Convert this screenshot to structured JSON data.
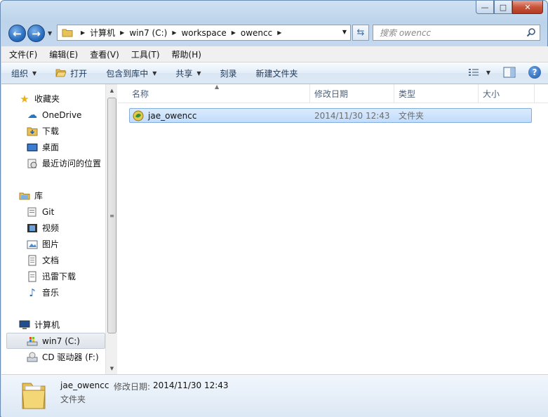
{
  "window": {
    "controls": {
      "minimize": "—",
      "maximize": "□",
      "close": "✕"
    }
  },
  "address": {
    "breadcrumbs": [
      "计算机",
      "win7 (C:)",
      "workspace",
      "owencc"
    ]
  },
  "search": {
    "placeholder": "搜索 owencc"
  },
  "menu": {
    "items": [
      "文件(F)",
      "编辑(E)",
      "查看(V)",
      "工具(T)",
      "帮助(H)"
    ]
  },
  "toolbar": {
    "organize": "组织",
    "open": "打开",
    "include_in_library": "包含到库中",
    "share": "共享",
    "burn": "刻录",
    "new_folder": "新建文件夹"
  },
  "nav": {
    "favorites": {
      "label": "收藏夹",
      "items": [
        "OneDrive",
        "下载",
        "桌面",
        "最近访问的位置"
      ]
    },
    "libraries": {
      "label": "库",
      "items": [
        "Git",
        "视频",
        "图片",
        "文档",
        "迅雷下载",
        "音乐"
      ]
    },
    "computer": {
      "label": "计算机",
      "items": [
        "win7 (C:)",
        "CD 驱动器 (F:)"
      ],
      "selected": "win7 (C:)"
    }
  },
  "columns": {
    "name": "名称",
    "modified": "修改日期",
    "type": "类型",
    "size": "大小"
  },
  "files": [
    {
      "name": "jae_owencc",
      "modified": "2014/11/30 12:43",
      "type": "文件夹",
      "size": ""
    }
  ],
  "details": {
    "name": "jae_owencc",
    "modified_label": "修改日期:",
    "modified_value": "2014/11/30 12:43",
    "type": "文件夹"
  }
}
